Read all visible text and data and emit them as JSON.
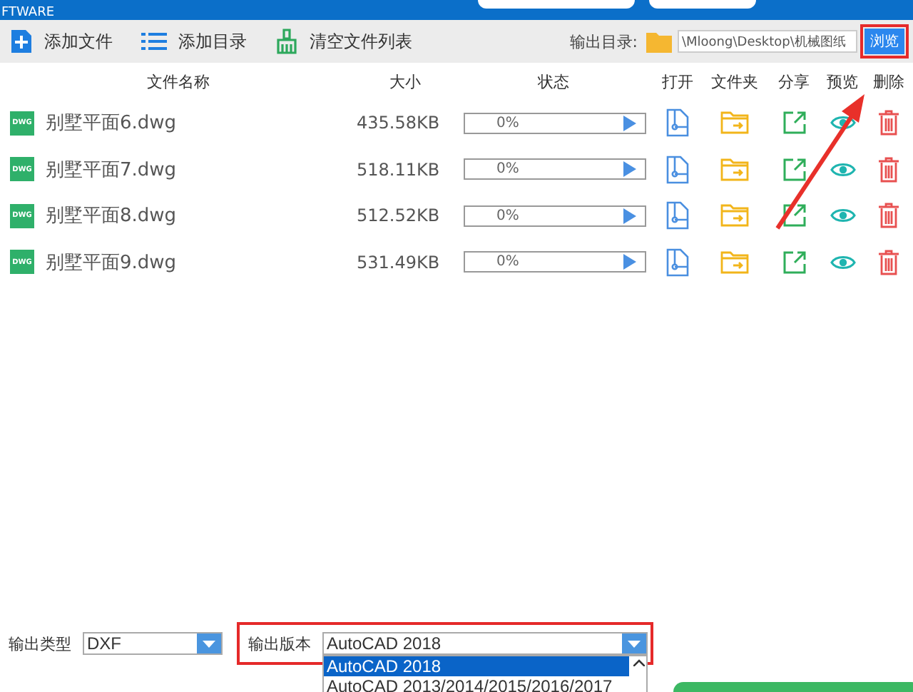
{
  "window": {
    "title": "FTWARE"
  },
  "toolbar": {
    "buttons": [
      {
        "kind": "add-file",
        "label": "添加文件"
      },
      {
        "kind": "add-folder",
        "label": "添加目录"
      },
      {
        "kind": "clear",
        "label": "清空文件列表"
      }
    ],
    "output_dir": {
      "label": "输出目录:",
      "value": "\\Mloong\\Desktop\\机械图纸",
      "button": "浏览",
      "highlighted": true
    }
  },
  "table": {
    "columns": [
      "文件名称",
      "大小",
      "状态",
      "打开",
      "文件夹",
      "分享",
      "预览",
      "删除"
    ],
    "rows": [
      {
        "badge": "DWG",
        "name": "别墅平面6.dwg",
        "size": "435.58KB",
        "status": "0%",
        "level": 0
      },
      {
        "badge": "DWG",
        "name": "别墅平面7.dwg",
        "size": "518.11KB",
        "status": "0%",
        "level": 0
      },
      {
        "badge": "DWG",
        "name": "别墅平面8.dwg",
        "size": "512.52KB",
        "status": "0%",
        "level": 0
      },
      {
        "badge": "DWG",
        "name": "别墅平面9.dwg",
        "size": "531.49KB",
        "status": "0%",
        "level": 0
      }
    ]
  },
  "annotation_arrow": true,
  "footer": {
    "output_type": {
      "label": "输出类型",
      "value": "DXF"
    },
    "output_version": {
      "label": "输出版本",
      "value": "AutoCAD 2018",
      "highlighted": true,
      "expanded": true,
      "options": [
        {
          "label": "AutoCAD 2018",
          "selected": true
        },
        {
          "label": "AutoCAD 2013/2014/2015/2016/2017",
          "selected": false
        }
      ]
    }
  }
}
